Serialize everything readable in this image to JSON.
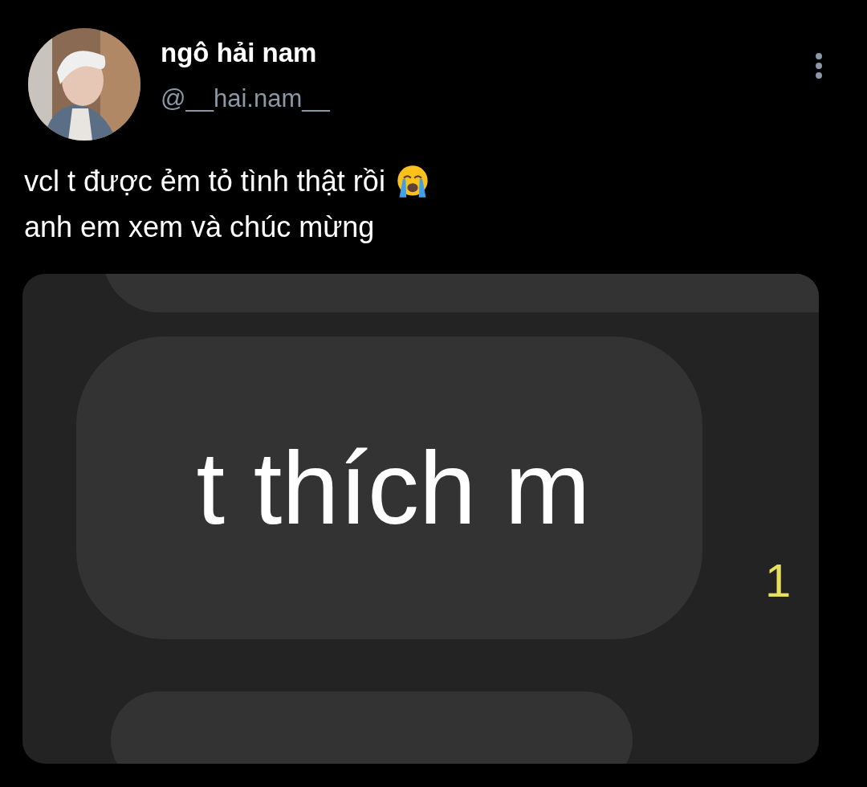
{
  "author": {
    "name": "ngô hải nam",
    "handle": "@__hai.nam__"
  },
  "text_lines": [
    "vcl t được ẻm tỏ tình thật rồi",
    "anh em xem và chúc mừng"
  ],
  "attached_screenshot": {
    "message": "t thích m",
    "unread_count": "1"
  }
}
